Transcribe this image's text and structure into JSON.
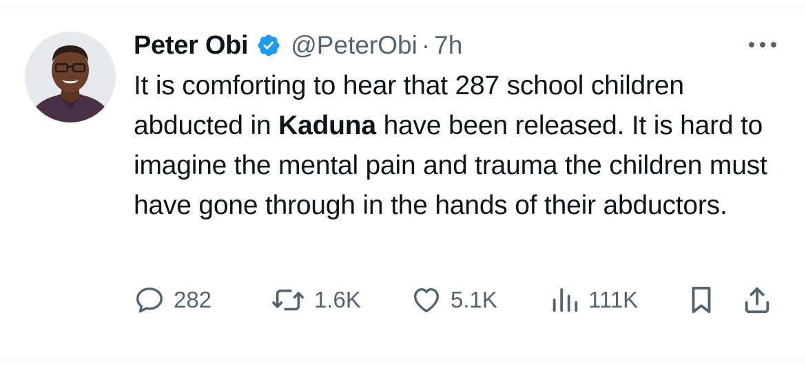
{
  "author": {
    "name": "Peter Obi",
    "handle": "@PeterObi",
    "separator": "·",
    "time": "7h",
    "verified": true,
    "verified_color": "#1d9bf0"
  },
  "tweet": {
    "text_before_bold": "It is comforting to hear that 287 school children abducted in ",
    "bold_text": "Kaduna",
    "text_after_bold": " have been released. It is hard to imagine the mental pain and trauma the children must have gone through in the hands of their abductors."
  },
  "actions": {
    "reply_count": "282",
    "repost_count": "1.6K",
    "like_count": "5.1K",
    "views_count": "111K"
  },
  "icons": {
    "avatar": "profile-photo",
    "verified": "verified-badge-icon",
    "more": "more-options-icon",
    "reply": "reply-icon",
    "repost": "repost-icon",
    "like": "heart-icon",
    "views": "views-icon",
    "bookmark": "bookmark-icon",
    "share": "share-icon"
  },
  "colors": {
    "text_primary": "#0f1419",
    "text_secondary": "#536471",
    "accent": "#1d9bf0"
  }
}
